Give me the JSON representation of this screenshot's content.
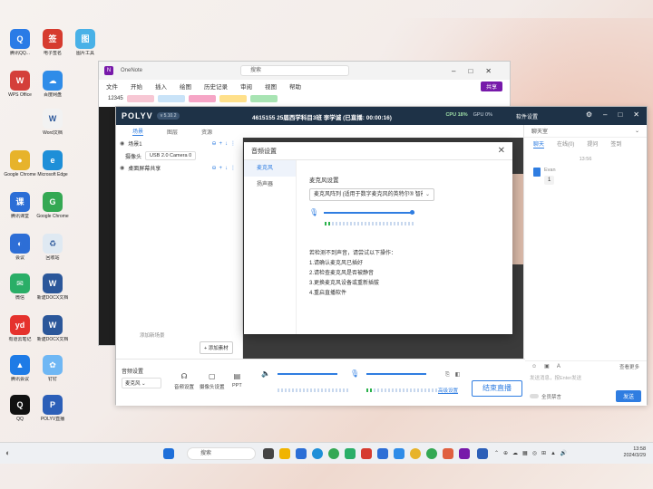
{
  "desktop_icons": [
    {
      "label": "腾讯QQ...",
      "color": "#2a7be6",
      "glyph": "Q"
    },
    {
      "label": "电子签名",
      "color": "#d63b2f",
      "glyph": "签"
    },
    {
      "label": "图片工具",
      "color": "#49b1e7",
      "glyph": "图"
    },
    {
      "label": "WPS Office",
      "color": "#d43f3a",
      "glyph": "W"
    },
    {
      "label": "百度网盘",
      "color": "#2f8ce8",
      "glyph": "☁"
    },
    {
      "label": "Word文档",
      "color": "#f2f2f2",
      "glyph": "W"
    },
    {
      "label": "Google Chrome",
      "color": "#e7b32b",
      "glyph": "●"
    },
    {
      "label": "Microsoft Edge",
      "color": "#1e8fd8",
      "glyph": "e"
    },
    {
      "label": "腾讯课堂",
      "color": "#2b6ed6",
      "glyph": "课"
    },
    {
      "label": "Google Chrome",
      "color": "#34a853",
      "glyph": "G"
    },
    {
      "label": "会议",
      "color": "#2d6ed6",
      "glyph": "◐"
    },
    {
      "label": "回收站",
      "color": "#dfe9f2",
      "glyph": "♻"
    },
    {
      "label": "微信",
      "color": "#2aae67",
      "glyph": "✉"
    },
    {
      "label": "新建DOCX文档",
      "color": "#2b579a",
      "glyph": "W"
    },
    {
      "label": "有道云笔记",
      "color": "#e5322d",
      "glyph": "yd"
    },
    {
      "label": "新建DOCX文档",
      "color": "#2b579a",
      "glyph": "W"
    },
    {
      "label": "腾讯会议",
      "color": "#1e7be6",
      "glyph": "▲"
    },
    {
      "label": "钉钉",
      "color": "#6fb7f4",
      "glyph": "✿"
    },
    {
      "label": "QQ",
      "color": "#111111",
      "glyph": "Q"
    },
    {
      "label": "POLYV直播",
      "color": "#2c5fb8",
      "glyph": "P"
    }
  ],
  "onenote": {
    "title": "OneNote",
    "search_placeholder": "搜索",
    "menu": [
      "文件",
      "开始",
      "插入",
      "绘图",
      "历史记录",
      "审阅",
      "视图",
      "帮助"
    ],
    "share_label": "共享",
    "notebook_label": "12345"
  },
  "polyv": {
    "logo": "POLYV",
    "version": "v 5.10.2",
    "session": "4615155 25届西学科目3班 李学诚 (已直播: 00:00:16)",
    "stats": "CPU 18%",
    "stats_extra": "GPU 0%",
    "settings_link": "软件设置",
    "tabs": [
      "场景",
      "图层",
      "资源"
    ],
    "scene_name": "场景1",
    "camera_label": "摄像头",
    "camera_select": "USB 2.0 Camera 0",
    "screen_name": "桌面屏幕共享",
    "add_scene": "添加新场景",
    "add_source": "添加素材",
    "bottom": {
      "mic_label": "音频设置",
      "mic_select": "麦克风",
      "btn_mic": "音频设置",
      "btn_camera": "摄像头设置",
      "btn_ppt": "PPT",
      "adv_link": "高级设置",
      "live_button": "结束直播"
    },
    "chat": {
      "header": "聊天室",
      "tabs": [
        "聊天",
        "在线(0)",
        "提问",
        "签到"
      ],
      "timestamp": "13:56",
      "msg_name": "Evan",
      "msg_text": "1",
      "input_placeholder": "发送消息，按Enter发送",
      "toggle_label": "全员禁言",
      "send_label": "发送",
      "tool_right": "查看更多"
    }
  },
  "modal": {
    "title": "音频设置",
    "side": [
      "麦克风",
      "扬声器"
    ],
    "field_label": "麦克风设置",
    "device": "麦克风阵列 (适用于数字麦克风的英特尔® 智能音频)",
    "hint_title": "若检测不到声音，请尝试以下操作：",
    "hints": [
      "1.请确认麦克风已插好",
      "2.请检查麦克风是否被静音",
      "3.更换麦克风设备或重新插拔",
      "4.重启直播软件"
    ]
  },
  "taskbar": {
    "search": "搜索",
    "time": "13:58",
    "date": "2024/3/29"
  }
}
